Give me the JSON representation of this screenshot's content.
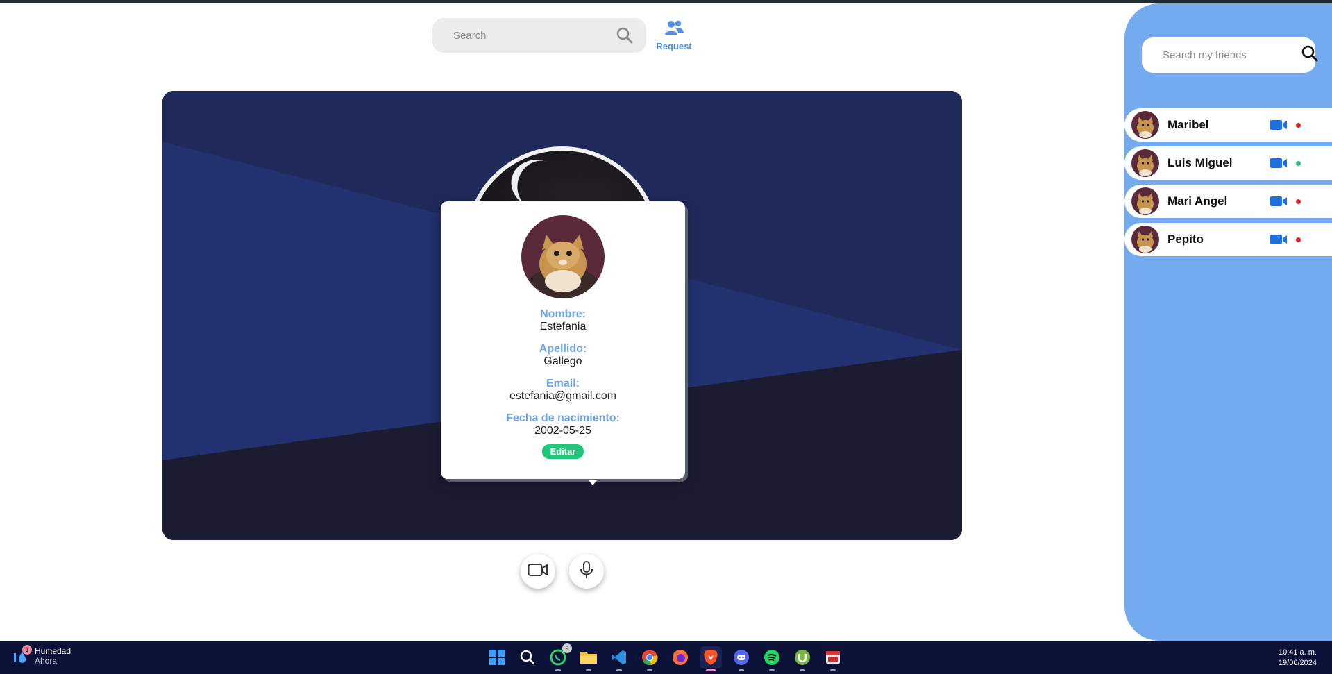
{
  "header": {
    "search_placeholder": "Search",
    "request_label": "Request"
  },
  "profile": {
    "fields": [
      {
        "label": "Nombre:",
        "value": "Estefania"
      },
      {
        "label": "Apellido:",
        "value": "Gallego"
      },
      {
        "label": "Email:",
        "value": "estefania@gmail.com"
      },
      {
        "label": "Fecha de nacimiento:",
        "value": "2002-05-25"
      }
    ],
    "edit_label": "Editar"
  },
  "sidebar": {
    "search_placeholder": "Search my friends",
    "friends": [
      {
        "name": "Maribel",
        "status": "offline"
      },
      {
        "name": "Luis Miguel",
        "status": "online"
      },
      {
        "name": "Mari Angel",
        "status": "offline"
      },
      {
        "name": "Pepito",
        "status": "offline"
      }
    ]
  },
  "colors": {
    "accent": "#74aaee",
    "online": "#1fc77b",
    "offline": "#e61a1a",
    "edit_button": "#1fc77b"
  },
  "taskbar": {
    "weather_badge": "1",
    "weather_title": "Humedad",
    "weather_sub": "Ahora",
    "whatsapp_badge": "9",
    "time": "10:41 a. m.",
    "date": "19/06/2024",
    "icons": [
      "windows-start-icon",
      "search-icon",
      "whatsapp-icon",
      "file-explorer-icon",
      "vscode-icon",
      "chrome-icon",
      "firefox-icon",
      "brave-icon",
      "discord-icon",
      "spotify-icon",
      "utorrent-icon",
      "app-icon"
    ]
  }
}
